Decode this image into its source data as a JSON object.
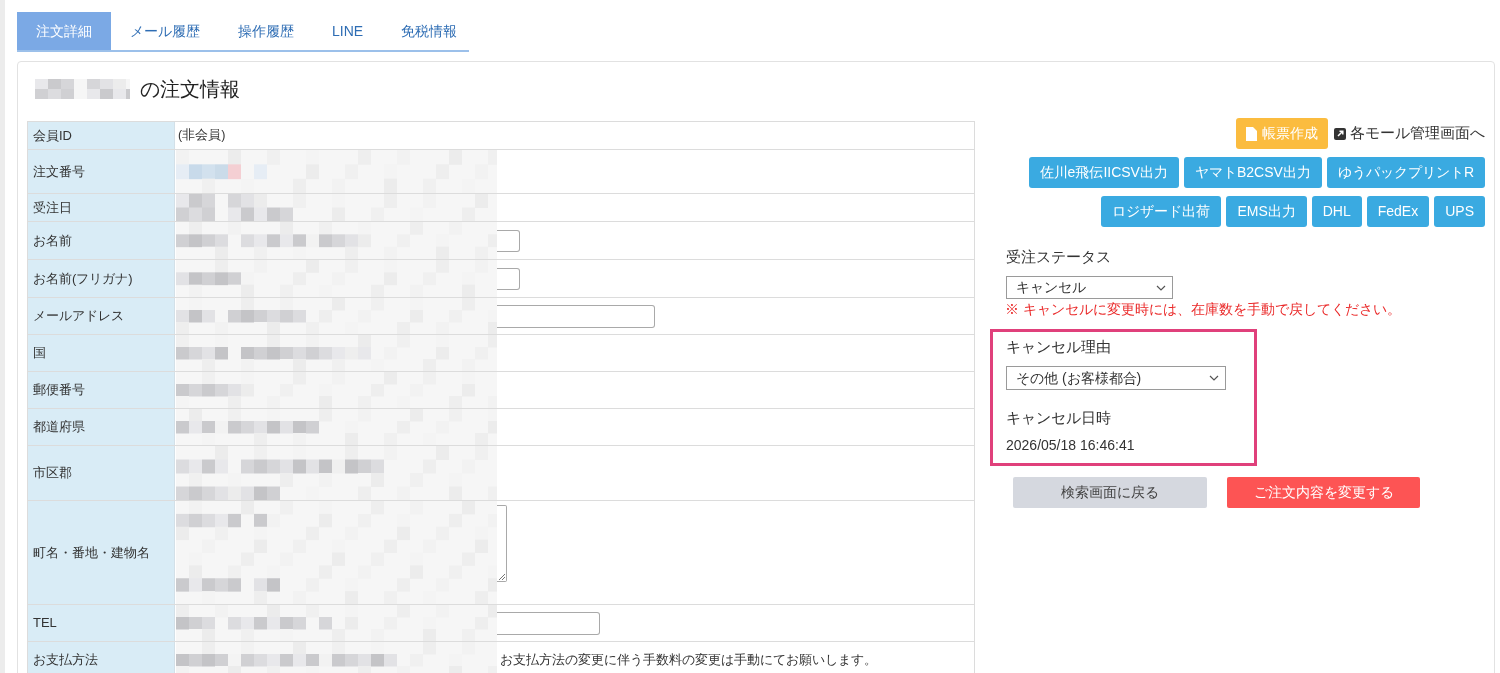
{
  "tabs": [
    {
      "label": "注文詳細",
      "selected": true
    },
    {
      "label": "メール履歴",
      "selected": false
    },
    {
      "label": "操作履歴",
      "selected": false
    },
    {
      "label": "LINE",
      "selected": false
    },
    {
      "label": "免税情報",
      "selected": false
    }
  ],
  "heading": {
    "redacted": true,
    "text": "の注文情報"
  },
  "order_table": {
    "rows": [
      {
        "label": "会員ID",
        "value": "(非会員)",
        "redacted": false,
        "kind": "text"
      },
      {
        "label": "注文番号",
        "redacted": true,
        "kind": "link"
      },
      {
        "label": "受注日",
        "redacted": true,
        "kind": "text"
      },
      {
        "label": "お名前",
        "redacted": true,
        "kind": "input"
      },
      {
        "label": "お名前(フリガナ)",
        "redacted": true,
        "kind": "input"
      },
      {
        "label": "メールアドレス",
        "redacted": true,
        "kind": "wide_input"
      },
      {
        "label": "国",
        "redacted": true,
        "kind": "select"
      },
      {
        "label": "郵便番号",
        "redacted": true,
        "kind": "select"
      },
      {
        "label": "都道府県",
        "redacted": true,
        "kind": "select"
      },
      {
        "label": "市区郡",
        "redacted": true,
        "kind": "multiline"
      },
      {
        "label": "町名・番地・建物名",
        "redacted": true,
        "kind": "textarea"
      },
      {
        "label": "TEL",
        "redacted": true,
        "kind": "tel_input"
      },
      {
        "label": "お支払方法",
        "redacted": true,
        "kind": "note",
        "note": "お支払方法の変更に伴う手数料の変更は手動にてお願いします。"
      }
    ]
  },
  "toolbar": {
    "document_button": "帳票作成",
    "mall_link": "各モール管理画面へ"
  },
  "shipping_buttons": [
    [
      "佐川e飛伝IICSV出力",
      "ヤマトB2CSV出力",
      "ゆうパックプリントR"
    ],
    [
      "ロジザード出荷",
      "EMS出力",
      "DHL",
      "FedEx",
      "UPS"
    ]
  ],
  "order_status": {
    "label": "受注ステータス",
    "value": "キャンセル",
    "warning": "※ キャンセルに変更時には、在庫数を手動で戻してください。"
  },
  "cancel_info": {
    "highlighted": true,
    "reason_label": "キャンセル理由",
    "reason_value": "その他 (お客様都合)",
    "date_label": "キャンセル日時",
    "date_value": "2026/05/18 16:46:41"
  },
  "actions": [
    {
      "label": "検索画面に戻る",
      "kind": "secondary"
    },
    {
      "label": "ご注文内容を変更する",
      "kind": "primary"
    }
  ]
}
